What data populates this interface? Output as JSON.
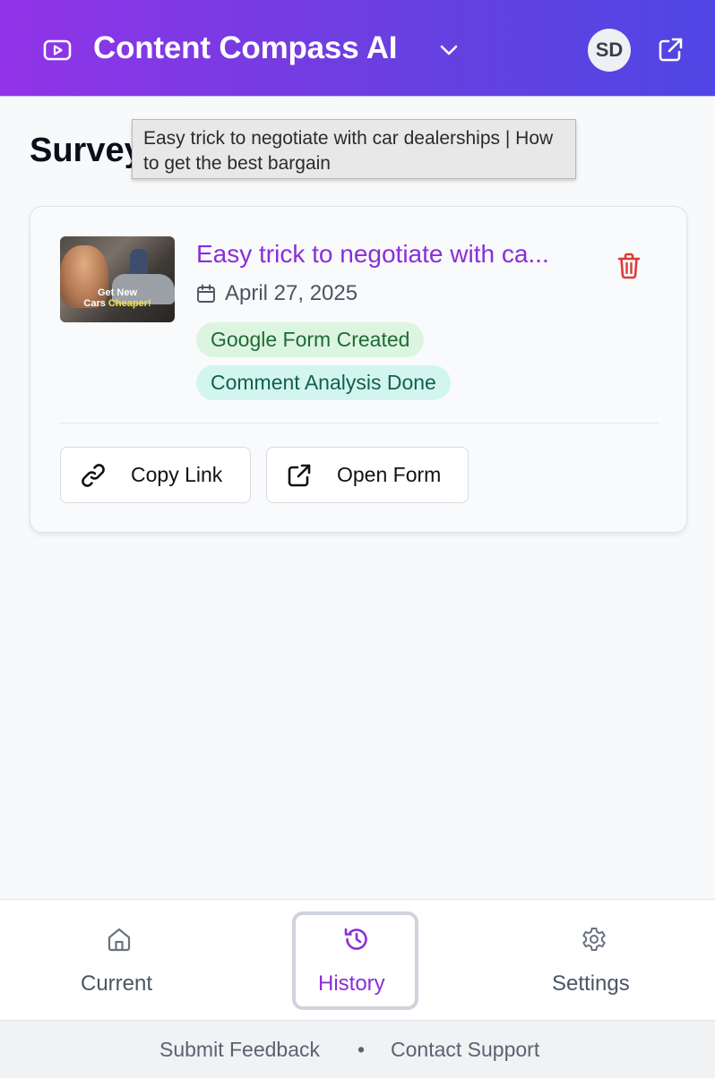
{
  "header": {
    "app_title": "Content Compass AI",
    "avatar_initials": "SD",
    "gradient_start": "#9233e8",
    "gradient_end": "#4f46e5"
  },
  "page": {
    "title": "Surveys"
  },
  "tooltip": {
    "text": "Easy trick to negotiate with car dealerships | How to get the best bargain"
  },
  "card": {
    "thumbnail": {
      "caption_line1": "Get New",
      "caption_line2_prefix": "Cars ",
      "caption_line2_highlight": "Cheaper!"
    },
    "title": "Easy trick to negotiate with ca...",
    "date": "April 27, 2025",
    "badges": [
      "Google Form Created",
      "Comment Analysis Done"
    ],
    "buttons": {
      "copy_link": "Copy Link",
      "open_form": "Open Form"
    },
    "accent_color": "#8a2fd6",
    "delete_color": "#dc3b3b"
  },
  "bottom_nav": {
    "items": [
      {
        "label": "Current",
        "icon": "home-icon"
      },
      {
        "label": "History",
        "icon": "history-icon",
        "active": true
      },
      {
        "label": "Settings",
        "icon": "gear-icon"
      }
    ]
  },
  "footer": {
    "feedback": "Submit Feedback",
    "separator": "•",
    "support": "Contact Support"
  }
}
